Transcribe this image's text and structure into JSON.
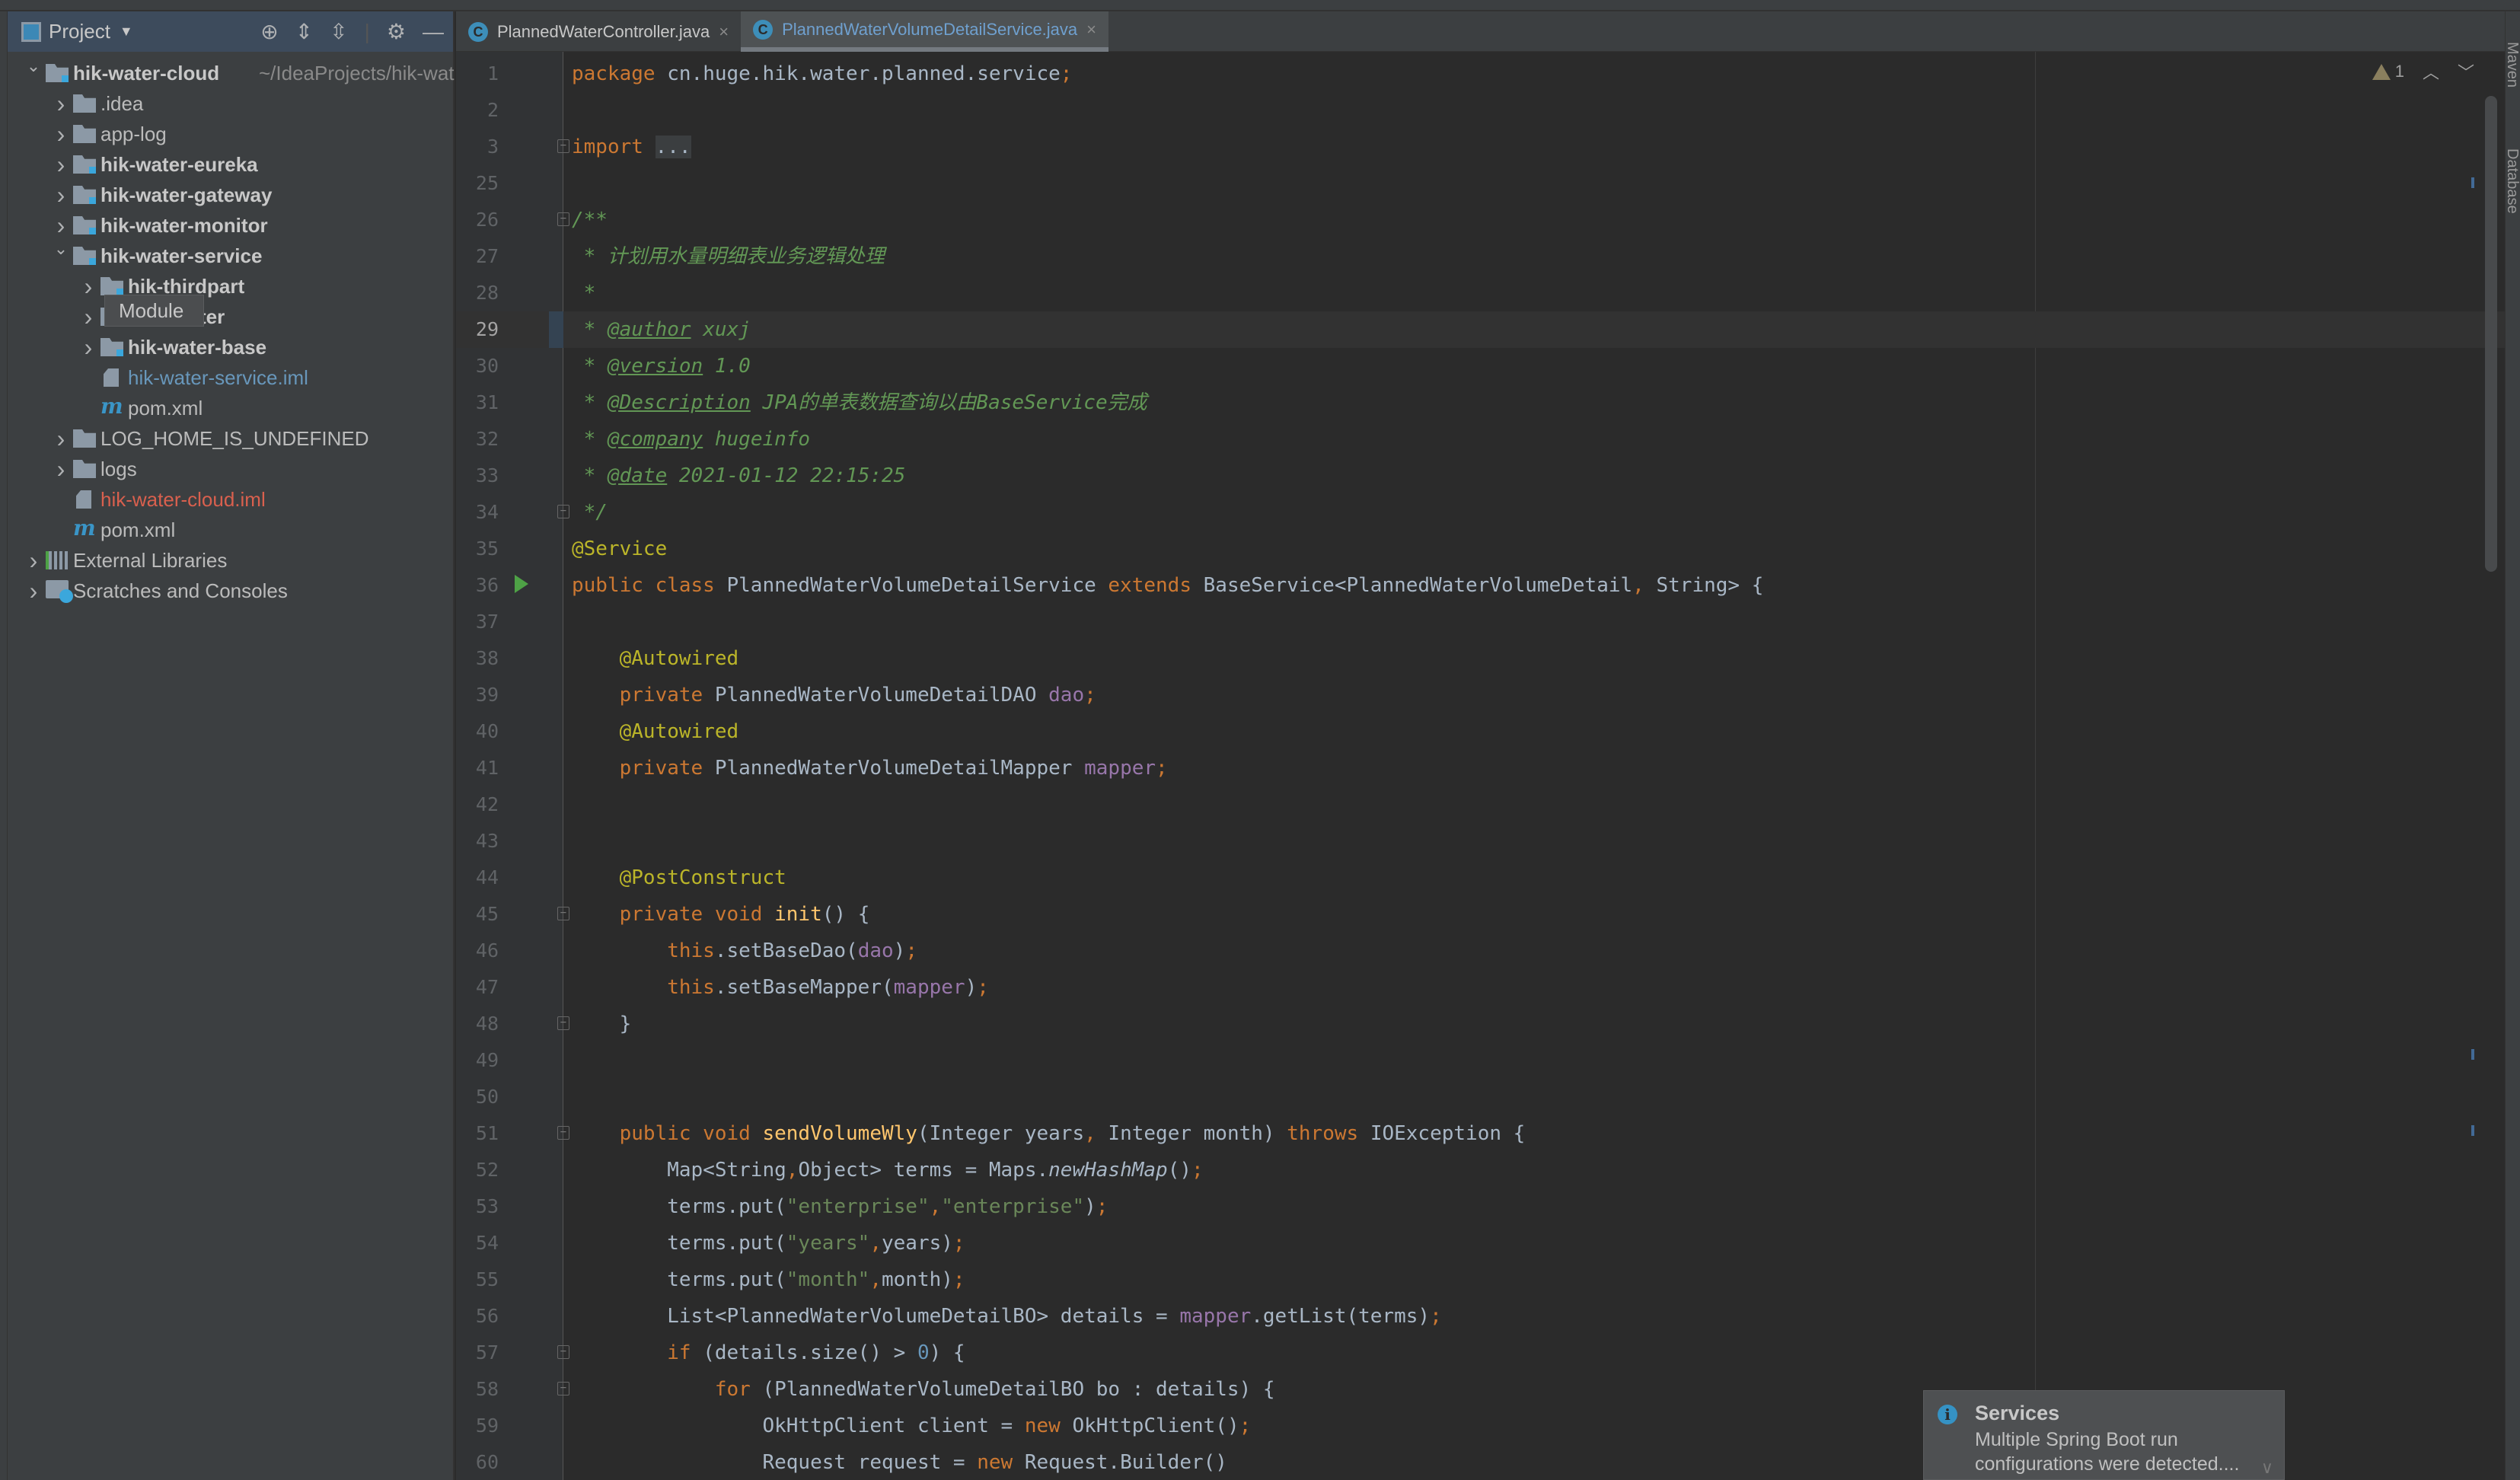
{
  "sidebar": {
    "title": "Project",
    "items": [
      {
        "level": 0,
        "chevron": "down",
        "icon": "module-folder",
        "label": "hik-water-cloud",
        "style": "bold",
        "suffix": "~/IdeaProjects/hik-wat"
      },
      {
        "level": 1,
        "chevron": "right",
        "icon": "folder",
        "label": ".idea",
        "style": ""
      },
      {
        "level": 1,
        "chevron": "right",
        "icon": "folder",
        "label": "app-log",
        "style": ""
      },
      {
        "level": 1,
        "chevron": "right",
        "icon": "module-folder",
        "label": "hik-water-eureka",
        "style": "bold"
      },
      {
        "level": 1,
        "chevron": "right",
        "icon": "module-folder",
        "label": "hik-water-gateway",
        "style": "bold"
      },
      {
        "level": 1,
        "chevron": "right",
        "icon": "module-folder",
        "label": "hik-water-monitor",
        "style": "bold"
      },
      {
        "level": 1,
        "chevron": "down",
        "icon": "module-folder",
        "label": "hik-water-service",
        "style": "bold"
      },
      {
        "level": 2,
        "chevron": "right",
        "icon": "module-folder",
        "label": "hik-thirdpart",
        "style": "bold"
      },
      {
        "level": 2,
        "chevron": "right",
        "icon": "module-folder",
        "label": "ter",
        "style": "bold",
        "covered": true
      },
      {
        "level": 2,
        "chevron": "right",
        "icon": "module-folder",
        "label": "hik-water-base",
        "style": "bold"
      },
      {
        "level": 2,
        "chevron": "",
        "icon": "iml-file",
        "label": "hik-water-service.iml",
        "style": "blue"
      },
      {
        "level": 2,
        "chevron": "",
        "icon": "maven",
        "label": "pom.xml",
        "style": ""
      },
      {
        "level": 1,
        "chevron": "right",
        "icon": "folder",
        "label": "LOG_HOME_IS_UNDEFINED",
        "style": ""
      },
      {
        "level": 1,
        "chevron": "right",
        "icon": "folder",
        "label": "logs",
        "style": ""
      },
      {
        "level": 1,
        "chevron": "",
        "icon": "iml-file",
        "label": "hik-water-cloud.iml",
        "style": "red"
      },
      {
        "level": 1,
        "chevron": "",
        "icon": "maven",
        "label": "pom.xml",
        "style": ""
      },
      {
        "level": 0,
        "chevron": "right",
        "icon": "libraries",
        "label": "External Libraries",
        "style": ""
      },
      {
        "level": 0,
        "chevron": "right",
        "icon": "scratches",
        "label": "Scratches and Consoles",
        "style": ""
      }
    ],
    "tooltip": "Module"
  },
  "tabs": [
    {
      "label": "PlannedWaterController.java",
      "active": false
    },
    {
      "label": "PlannedWaterVolumeDetailService.java",
      "active": true
    }
  ],
  "inspection": {
    "warnings": "1"
  },
  "right_toolbar": [
    "Maven",
    "Database"
  ],
  "editor": {
    "caret_line": 29,
    "lines": [
      {
        "n": "1",
        "t": [
          [
            "kw",
            "package "
          ],
          [
            "plain",
            "cn.huge.hik.water.planned.service"
          ],
          [
            "kw",
            ";"
          ]
        ]
      },
      {
        "n": "2",
        "t": []
      },
      {
        "n": "3",
        "fold": true,
        "t": [
          [
            "kw",
            "import "
          ],
          [
            "fbox",
            "..."
          ]
        ]
      },
      {
        "n": "25",
        "t": []
      },
      {
        "n": "26",
        "fold": true,
        "t": [
          [
            "doc",
            "/**"
          ]
        ]
      },
      {
        "n": "27",
        "t": [
          [
            "doc",
            " * 计划用水量明细表业务逻辑处理"
          ]
        ]
      },
      {
        "n": "28",
        "t": [
          [
            "doc",
            " *"
          ]
        ]
      },
      {
        "n": "29",
        "t": [
          [
            "doc",
            " * "
          ],
          [
            "dtag",
            "@author"
          ],
          [
            "doc",
            " xuxj"
          ]
        ]
      },
      {
        "n": "30",
        "t": [
          [
            "doc",
            " * "
          ],
          [
            "dtag",
            "@version"
          ],
          [
            "doc",
            " 1.0"
          ]
        ]
      },
      {
        "n": "31",
        "t": [
          [
            "doc",
            " * "
          ],
          [
            "dtag",
            "@Description"
          ],
          [
            "doc",
            " JPA的单表数据查询以由BaseService完成"
          ]
        ]
      },
      {
        "n": "32",
        "t": [
          [
            "doc",
            " * "
          ],
          [
            "dtag",
            "@company"
          ],
          [
            "doc",
            " hugeinfo"
          ]
        ]
      },
      {
        "n": "33",
        "t": [
          [
            "doc",
            " * "
          ],
          [
            "dtag",
            "@date"
          ],
          [
            "doc",
            " 2021-01-12 22:15:25"
          ]
        ]
      },
      {
        "n": "34",
        "fold": true,
        "t": [
          [
            "doc",
            " */"
          ]
        ]
      },
      {
        "n": "35",
        "t": [
          [
            "ann",
            "@Service"
          ]
        ]
      },
      {
        "n": "36",
        "run": true,
        "t": [
          [
            "kw",
            "public class "
          ],
          [
            "plain",
            "PlannedWaterVolumeDetailService "
          ],
          [
            "kw",
            "extends "
          ],
          [
            "plain",
            "BaseService<PlannedWaterVolumeDetail"
          ],
          [
            "kw",
            ", "
          ],
          [
            "plain",
            "String> {"
          ]
        ]
      },
      {
        "n": "37",
        "t": []
      },
      {
        "n": "38",
        "t": [
          [
            "plain",
            "    "
          ],
          [
            "ann",
            "@Autowired"
          ]
        ]
      },
      {
        "n": "39",
        "t": [
          [
            "kw",
            "    private "
          ],
          [
            "plain",
            "PlannedWaterVolumeDetailDAO "
          ],
          [
            "fld",
            "dao"
          ],
          [
            "kw",
            ";"
          ]
        ]
      },
      {
        "n": "40",
        "t": [
          [
            "plain",
            "    "
          ],
          [
            "ann",
            "@Autowired"
          ]
        ]
      },
      {
        "n": "41",
        "t": [
          [
            "kw",
            "    private "
          ],
          [
            "plain",
            "PlannedWaterVolumeDetailMapper "
          ],
          [
            "fld",
            "mapper"
          ],
          [
            "kw",
            ";"
          ]
        ]
      },
      {
        "n": "42",
        "t": []
      },
      {
        "n": "43",
        "t": []
      },
      {
        "n": "44",
        "t": [
          [
            "plain",
            "    "
          ],
          [
            "ann",
            "@PostConstruct"
          ]
        ]
      },
      {
        "n": "45",
        "fold": true,
        "t": [
          [
            "kw",
            "    private void "
          ],
          [
            "fn",
            "init"
          ],
          [
            "plain",
            "() {"
          ]
        ]
      },
      {
        "n": "46",
        "t": [
          [
            "kw",
            "        this"
          ],
          [
            "plain",
            ".setBaseDao("
          ],
          [
            "fld",
            "dao"
          ],
          [
            "plain",
            ")"
          ],
          [
            "kw",
            ";"
          ]
        ]
      },
      {
        "n": "47",
        "t": [
          [
            "kw",
            "        this"
          ],
          [
            "plain",
            ".setBaseMapper("
          ],
          [
            "fld",
            "mapper"
          ],
          [
            "plain",
            ")"
          ],
          [
            "kw",
            ";"
          ]
        ]
      },
      {
        "n": "48",
        "fold": true,
        "t": [
          [
            "plain",
            "    }"
          ]
        ]
      },
      {
        "n": "49",
        "t": []
      },
      {
        "n": "50",
        "t": []
      },
      {
        "n": "51",
        "fold": true,
        "t": [
          [
            "kw",
            "    public void "
          ],
          [
            "fn",
            "sendVolumeWly"
          ],
          [
            "plain",
            "(Integer years"
          ],
          [
            "kw",
            ", "
          ],
          [
            "plain",
            "Integer month) "
          ],
          [
            "kw",
            "throws "
          ],
          [
            "plain",
            "IOException {"
          ]
        ]
      },
      {
        "n": "52",
        "t": [
          [
            "plain",
            "        Map<String"
          ],
          [
            "kw",
            ","
          ],
          [
            "plain",
            "Object> terms = Maps."
          ],
          [
            "ital",
            "newHashMap"
          ],
          [
            "plain",
            "()"
          ],
          [
            "kw",
            ";"
          ]
        ]
      },
      {
        "n": "53",
        "t": [
          [
            "plain",
            "        terms.put("
          ],
          [
            "str",
            "\"enterprise\""
          ],
          [
            "kw",
            ","
          ],
          [
            "str",
            "\"enterprise\""
          ],
          [
            "plain",
            ")"
          ],
          [
            "kw",
            ";"
          ]
        ]
      },
      {
        "n": "54",
        "t": [
          [
            "plain",
            "        terms.put("
          ],
          [
            "str",
            "\"years\""
          ],
          [
            "kw",
            ","
          ],
          [
            "plain",
            "years)"
          ],
          [
            "kw",
            ";"
          ]
        ]
      },
      {
        "n": "55",
        "t": [
          [
            "plain",
            "        terms.put("
          ],
          [
            "str",
            "\"month\""
          ],
          [
            "kw",
            ","
          ],
          [
            "plain",
            "month)"
          ],
          [
            "kw",
            ";"
          ]
        ]
      },
      {
        "n": "56",
        "t": [
          [
            "plain",
            "        List<PlannedWaterVolumeDetailBO> details = "
          ],
          [
            "fld",
            "mapper"
          ],
          [
            "plain",
            ".getList(terms)"
          ],
          [
            "kw",
            ";"
          ]
        ]
      },
      {
        "n": "57",
        "fold": true,
        "t": [
          [
            "kw",
            "        if "
          ],
          [
            "plain",
            "(details.size() > "
          ],
          [
            "num",
            "0"
          ],
          [
            "plain",
            ") {"
          ]
        ]
      },
      {
        "n": "58",
        "fold": true,
        "t": [
          [
            "kw",
            "            for "
          ],
          [
            "plain",
            "(PlannedWaterVolumeDetailBO bo : details) {"
          ]
        ]
      },
      {
        "n": "59",
        "t": [
          [
            "plain",
            "                OkHttpClient client = "
          ],
          [
            "kw",
            "new "
          ],
          [
            "plain",
            "OkHttpClient()"
          ],
          [
            "kw",
            ";"
          ]
        ]
      },
      {
        "n": "60",
        "t": [
          [
            "plain",
            "                Request request = "
          ],
          [
            "kw",
            "new "
          ],
          [
            "plain",
            "Request.Builder()"
          ]
        ]
      }
    ]
  },
  "notification": {
    "icon": "info-icon",
    "title": "Services",
    "body": "Multiple Spring Boot run configurations were detected...."
  },
  "colors": {
    "keyword": "#cc7832",
    "annotation": "#bbb529",
    "string": "#6a8759",
    "number": "#6897bb",
    "field": "#9876aa",
    "method": "#ffc66d",
    "doc": "#629755",
    "text": "#a9b7c6",
    "background": "#2b2b2b"
  }
}
